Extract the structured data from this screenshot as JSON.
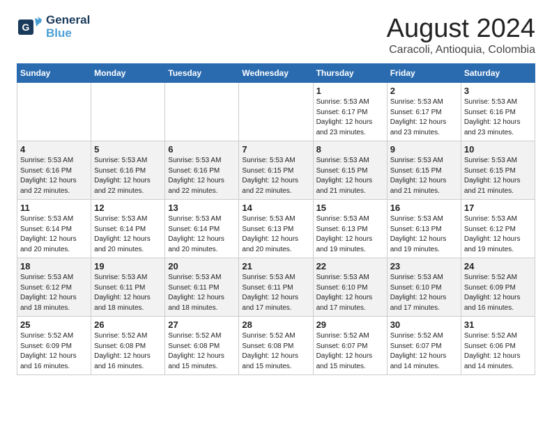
{
  "logo": {
    "line1": "General",
    "line2": "Blue"
  },
  "title": "August 2024",
  "subtitle": "Caracoli, Antioquia, Colombia",
  "weekdays": [
    "Sunday",
    "Monday",
    "Tuesday",
    "Wednesday",
    "Thursday",
    "Friday",
    "Saturday"
  ],
  "weeks": [
    [
      {
        "day": "",
        "info": ""
      },
      {
        "day": "",
        "info": ""
      },
      {
        "day": "",
        "info": ""
      },
      {
        "day": "",
        "info": ""
      },
      {
        "day": "1",
        "info": "Sunrise: 5:53 AM\nSunset: 6:17 PM\nDaylight: 12 hours\nand 23 minutes."
      },
      {
        "day": "2",
        "info": "Sunrise: 5:53 AM\nSunset: 6:17 PM\nDaylight: 12 hours\nand 23 minutes."
      },
      {
        "day": "3",
        "info": "Sunrise: 5:53 AM\nSunset: 6:16 PM\nDaylight: 12 hours\nand 23 minutes."
      }
    ],
    [
      {
        "day": "4",
        "info": "Sunrise: 5:53 AM\nSunset: 6:16 PM\nDaylight: 12 hours\nand 22 minutes."
      },
      {
        "day": "5",
        "info": "Sunrise: 5:53 AM\nSunset: 6:16 PM\nDaylight: 12 hours\nand 22 minutes."
      },
      {
        "day": "6",
        "info": "Sunrise: 5:53 AM\nSunset: 6:16 PM\nDaylight: 12 hours\nand 22 minutes."
      },
      {
        "day": "7",
        "info": "Sunrise: 5:53 AM\nSunset: 6:15 PM\nDaylight: 12 hours\nand 22 minutes."
      },
      {
        "day": "8",
        "info": "Sunrise: 5:53 AM\nSunset: 6:15 PM\nDaylight: 12 hours\nand 21 minutes."
      },
      {
        "day": "9",
        "info": "Sunrise: 5:53 AM\nSunset: 6:15 PM\nDaylight: 12 hours\nand 21 minutes."
      },
      {
        "day": "10",
        "info": "Sunrise: 5:53 AM\nSunset: 6:15 PM\nDaylight: 12 hours\nand 21 minutes."
      }
    ],
    [
      {
        "day": "11",
        "info": "Sunrise: 5:53 AM\nSunset: 6:14 PM\nDaylight: 12 hours\nand 20 minutes."
      },
      {
        "day": "12",
        "info": "Sunrise: 5:53 AM\nSunset: 6:14 PM\nDaylight: 12 hours\nand 20 minutes."
      },
      {
        "day": "13",
        "info": "Sunrise: 5:53 AM\nSunset: 6:14 PM\nDaylight: 12 hours\nand 20 minutes."
      },
      {
        "day": "14",
        "info": "Sunrise: 5:53 AM\nSunset: 6:13 PM\nDaylight: 12 hours\nand 20 minutes."
      },
      {
        "day": "15",
        "info": "Sunrise: 5:53 AM\nSunset: 6:13 PM\nDaylight: 12 hours\nand 19 minutes."
      },
      {
        "day": "16",
        "info": "Sunrise: 5:53 AM\nSunset: 6:13 PM\nDaylight: 12 hours\nand 19 minutes."
      },
      {
        "day": "17",
        "info": "Sunrise: 5:53 AM\nSunset: 6:12 PM\nDaylight: 12 hours\nand 19 minutes."
      }
    ],
    [
      {
        "day": "18",
        "info": "Sunrise: 5:53 AM\nSunset: 6:12 PM\nDaylight: 12 hours\nand 18 minutes."
      },
      {
        "day": "19",
        "info": "Sunrise: 5:53 AM\nSunset: 6:11 PM\nDaylight: 12 hours\nand 18 minutes."
      },
      {
        "day": "20",
        "info": "Sunrise: 5:53 AM\nSunset: 6:11 PM\nDaylight: 12 hours\nand 18 minutes."
      },
      {
        "day": "21",
        "info": "Sunrise: 5:53 AM\nSunset: 6:11 PM\nDaylight: 12 hours\nand 17 minutes."
      },
      {
        "day": "22",
        "info": "Sunrise: 5:53 AM\nSunset: 6:10 PM\nDaylight: 12 hours\nand 17 minutes."
      },
      {
        "day": "23",
        "info": "Sunrise: 5:53 AM\nSunset: 6:10 PM\nDaylight: 12 hours\nand 17 minutes."
      },
      {
        "day": "24",
        "info": "Sunrise: 5:52 AM\nSunset: 6:09 PM\nDaylight: 12 hours\nand 16 minutes."
      }
    ],
    [
      {
        "day": "25",
        "info": "Sunrise: 5:52 AM\nSunset: 6:09 PM\nDaylight: 12 hours\nand 16 minutes."
      },
      {
        "day": "26",
        "info": "Sunrise: 5:52 AM\nSunset: 6:08 PM\nDaylight: 12 hours\nand 16 minutes."
      },
      {
        "day": "27",
        "info": "Sunrise: 5:52 AM\nSunset: 6:08 PM\nDaylight: 12 hours\nand 15 minutes."
      },
      {
        "day": "28",
        "info": "Sunrise: 5:52 AM\nSunset: 6:08 PM\nDaylight: 12 hours\nand 15 minutes."
      },
      {
        "day": "29",
        "info": "Sunrise: 5:52 AM\nSunset: 6:07 PM\nDaylight: 12 hours\nand 15 minutes."
      },
      {
        "day": "30",
        "info": "Sunrise: 5:52 AM\nSunset: 6:07 PM\nDaylight: 12 hours\nand 14 minutes."
      },
      {
        "day": "31",
        "info": "Sunrise: 5:52 AM\nSunset: 6:06 PM\nDaylight: 12 hours\nand 14 minutes."
      }
    ]
  ]
}
